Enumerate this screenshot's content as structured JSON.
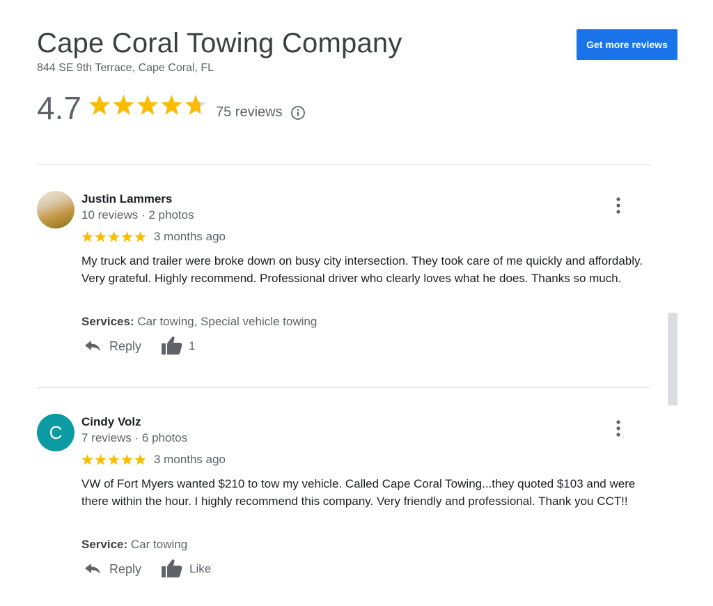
{
  "business": {
    "name": "Cape Coral Towing Company",
    "address": "844 SE 9th Terrace, Cape Coral, FL",
    "cta_label": "Get more reviews",
    "rating": "4.7",
    "rating_value": 4.7,
    "reviews_count": "75 reviews"
  },
  "colors": {
    "star": "#fbbc04",
    "star_empty": "#dadce0",
    "cta": "#1a73e8",
    "avatar_letter_bg": "#0c9aa3"
  },
  "icons": {
    "info": "info-circle-icon",
    "more": "more-vert-icon",
    "reply": "reply-arrow-icon",
    "like": "thumb-up-icon",
    "star": "star-icon"
  },
  "reviews": [
    {
      "name": "Justin Lammers",
      "meta": "10 reviews · 2 photos",
      "stars": 5,
      "time": "3 months ago",
      "text": "My truck and trailer were broke down on busy city intersection.  They took care of me quickly and affordably.  Very grateful.  Highly recommend.  Professional driver who clearly loves what he does.  Thanks so much.",
      "services_label": "Services:",
      "services_value": " Car towing, Special vehicle towing",
      "reply_label": "Reply",
      "like_label": "1",
      "avatar": "photo"
    },
    {
      "name": "Cindy Volz",
      "meta": "7 reviews · 6 photos",
      "stars": 5,
      "time": "3 months ago",
      "text": "VW of Fort Myers wanted $210 to tow my vehicle. Called Cape Coral Towing...they quoted $103 and were there within the hour. I highly recommend this company. Very friendly and professional. Thank you CCT!!",
      "services_label": "Service:",
      "services_value": " Car towing",
      "reply_label": "Reply",
      "like_label": "Like",
      "avatar": "letter",
      "avatar_letter": "C"
    }
  ]
}
